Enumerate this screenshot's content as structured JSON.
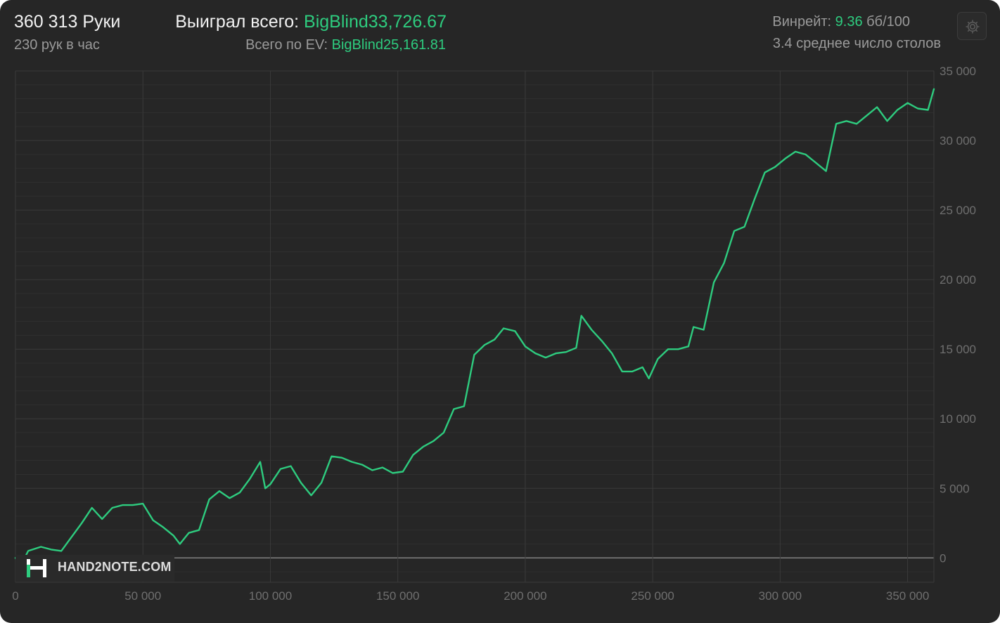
{
  "header": {
    "hands": "360 313 Руки",
    "hands_per_hour": "230 рук в час",
    "won_label": "Выиграл всего:",
    "won_value": "BigBlind33,726.67",
    "ev_label": "Всего по EV:",
    "ev_value": "BigBlind25,161.81",
    "winrate_label": "Винрейт:",
    "winrate_value": "9.36",
    "winrate_unit": "бб/100",
    "avg_tables": "3.4 среднее число столов"
  },
  "settings_button": {
    "icon": "gear-icon"
  },
  "logo": {
    "text": "HAND2NOTE.COM"
  },
  "colors": {
    "background": "#262626",
    "line": "#2ecc7f",
    "grid": "#3a3a3a",
    "zero_line": "#8a8a8a",
    "accent_green": "#2ecc7f"
  },
  "chart_data": {
    "type": "line",
    "x_ticks": [
      0,
      50000,
      100000,
      150000,
      200000,
      250000,
      300000,
      350000
    ],
    "x_tick_labels": [
      "0",
      "50 000",
      "100 000",
      "150 000",
      "200 000",
      "250 000",
      "300 000",
      "350 000"
    ],
    "y_ticks": [
      0,
      5000,
      10000,
      15000,
      20000,
      25000,
      30000,
      35000
    ],
    "y_tick_labels": [
      "0",
      "5 000",
      "10 000",
      "15 000",
      "20 000",
      "25 000",
      "30 000",
      "35 000"
    ],
    "xlim": [
      0,
      360313
    ],
    "ylim": [
      -1750,
      35000
    ],
    "grid": true,
    "y_axis_side": "right",
    "series": [
      {
        "x": [
          0,
          2000,
          5000,
          10000,
          14000,
          18000,
          22000,
          26000,
          30000,
          34000,
          38000,
          42000,
          46000,
          50000,
          54000,
          58000,
          62000,
          64500,
          68000,
          72000,
          76000,
          80000,
          84000,
          88000,
          92000,
          96000,
          98000,
          100000,
          104000,
          108000,
          112000,
          116000,
          120000,
          124000,
          128000,
          132000,
          136000,
          140000,
          144000,
          148000,
          152000,
          156000,
          160000,
          164000,
          168000,
          172000,
          176000,
          180000,
          184000,
          188000,
          191500,
          196000,
          200000,
          204000,
          208000,
          212000,
          216000,
          220000,
          222000,
          226000,
          230000,
          234000,
          238000,
          242000,
          246000,
          248500,
          252000,
          256000,
          260000,
          264000,
          266000,
          270000,
          274000,
          278000,
          282000,
          286000,
          290000,
          294000,
          298000,
          302000,
          306000,
          310000,
          314000,
          318000,
          322000,
          326000,
          330000,
          334000,
          338000,
          342000,
          346000,
          350000,
          354000,
          358000,
          360313
        ],
        "y": [
          0,
          -600,
          500,
          800,
          600,
          500,
          1500,
          2500,
          3600,
          2800,
          3600,
          3800,
          3800,
          3900,
          2700,
          2200,
          1600,
          1000,
          1800,
          2000,
          4200,
          4800,
          4300,
          4700,
          5700,
          6900,
          5000,
          5300,
          6400,
          6600,
          5400,
          4500,
          5400,
          7300,
          7200,
          6900,
          6700,
          6300,
          6500,
          6100,
          6200,
          7400,
          8000,
          8400,
          9000,
          10700,
          10900,
          14600,
          15300,
          15700,
          16500,
          16300,
          15200,
          14700,
          14400,
          14700,
          14800,
          15100,
          17400,
          16400,
          15600,
          14700,
          13400,
          13400,
          13700,
          12900,
          14300,
          15000,
          15000,
          15200,
          16600,
          16400,
          19800,
          21200,
          23500,
          23800,
          25800,
          27700,
          28100,
          28700,
          29200,
          29000,
          28400,
          27800,
          31200,
          31400,
          31200,
          31800,
          32400,
          31400,
          32200,
          32700,
          32300,
          32200,
          33700
        ]
      }
    ]
  }
}
